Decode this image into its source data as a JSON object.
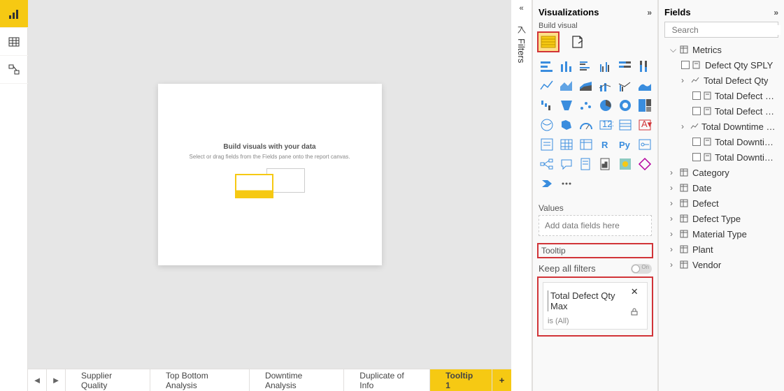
{
  "leftbar": {
    "view_report": "report",
    "view_table": "table",
    "view_model": "model"
  },
  "canvas": {
    "placeholder_title": "Build visuals with your data",
    "placeholder_sub": "Select or drag fields from the Fields pane onto the report canvas."
  },
  "tabs": {
    "items": [
      "Supplier Quality",
      "Top Bottom Analysis",
      "Downtime Analysis",
      "Duplicate of Info",
      "Tooltip 1"
    ],
    "active_index": 4
  },
  "filters_collapsed_label": "Filters",
  "viz": {
    "title": "Visualizations",
    "sub": "Build visual",
    "values_label": "Values",
    "values_drop": "Add data fields here",
    "tooltip_label": "Tooltip",
    "keep_filters": "Keep all filters",
    "toggle_text": "On",
    "field_name": "Total Defect Qty Max",
    "field_cond": "is (All)"
  },
  "fields": {
    "title": "Fields",
    "search_ph": "Search",
    "metrics": "Metrics",
    "defect_qty_sply": "Defect Qty SPLY",
    "total_defect_qty": "Total Defect Qty",
    "tdq1": "Total Defect Qty …",
    "tdq2": "Total Defect Rep…",
    "downtime_min": "Total Downtime Min…",
    "dt1": "Total Downtime …",
    "dt2": "Total Downtime …",
    "category": "Category",
    "date": "Date",
    "defect": "Defect",
    "defect_type": "Defect Type",
    "material_type": "Material Type",
    "plant": "Plant",
    "vendor": "Vendor"
  }
}
